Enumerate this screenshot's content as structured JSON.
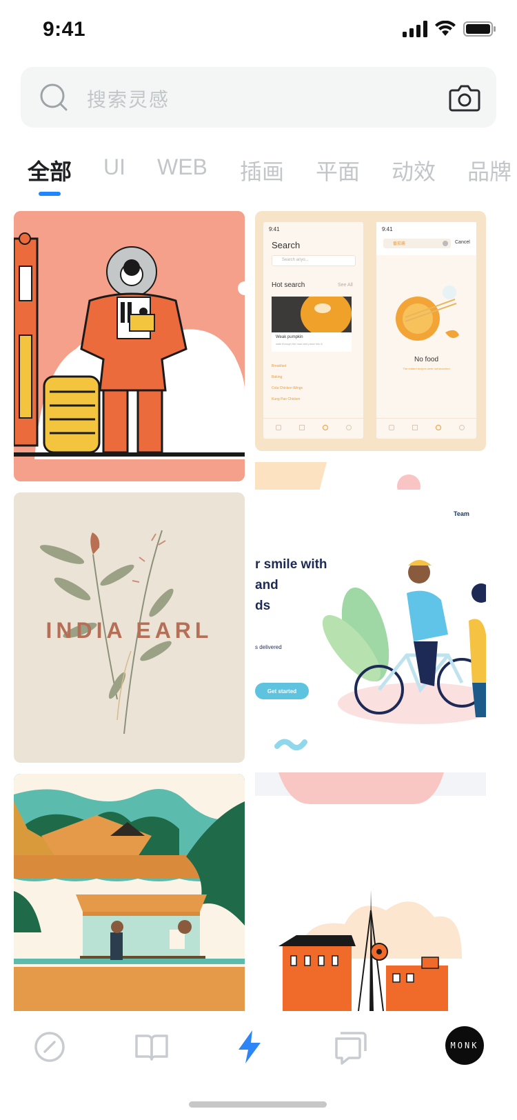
{
  "status_bar": {
    "time": "9:41"
  },
  "search": {
    "placeholder": "搜索灵感"
  },
  "tabs": [
    {
      "label": "全部"
    },
    {
      "label": "UI"
    },
    {
      "label": "WEB"
    },
    {
      "label": "插画"
    },
    {
      "label": "平面"
    },
    {
      "label": "动效"
    },
    {
      "label": "品牌"
    }
  ],
  "feed": {
    "card2": {
      "screen1": {
        "time": "9:41",
        "title": "Search",
        "search_placeholder": "Search anyo...",
        "hot_search": "Hot search",
        "see_all": "See All",
        "item_title": "Weak pumpkin",
        "item_desc": "walk through the road and place into it",
        "links": [
          "Breakfast",
          "Baking",
          "Cola Chicken Wings",
          "Kung Pao Chicken"
        ]
      },
      "screen2": {
        "time": "9:41",
        "search_value": "番茄酱",
        "cancel": "Cancel",
        "empty_title": "No food",
        "empty_desc": "The related recipes were not searched"
      }
    },
    "card3": {
      "text": "INDIA EARL"
    },
    "card4": {
      "nav": "Team",
      "headline": [
        "r smile with",
        "and",
        "ds"
      ],
      "subline": "s delivered",
      "cta": "Get started"
    }
  },
  "tab_bar": {
    "avatar_text": "MONK",
    "items": [
      "compass-icon",
      "book-icon",
      "lightning-icon",
      "chat-icon",
      "avatar"
    ],
    "active_color": "#2d86f7",
    "inactive_color": "#c8ccd0"
  },
  "colors": {
    "accent": "#1e86ff"
  }
}
